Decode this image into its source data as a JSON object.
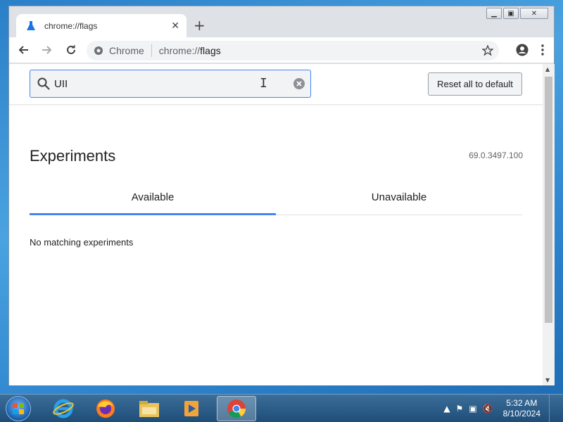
{
  "browser": {
    "tab_title": "chrome://flags",
    "new_tab_symbol": "+",
    "close_symbol": "✕",
    "omnibox": {
      "chip_label": "Chrome",
      "url_prefix": "chrome://",
      "url_host": "flags"
    }
  },
  "page": {
    "search_value": "UII",
    "reset_button_label": "Reset all to default",
    "title": "Experiments",
    "version": "69.0.3497.100",
    "tabs": [
      {
        "label": "Available",
        "selected": true
      },
      {
        "label": "Unavailable",
        "selected": false
      }
    ],
    "empty_message": "No matching experiments"
  },
  "taskbar": {
    "apps": [
      "internet-explorer-icon",
      "firefox-icon",
      "file-explorer-icon",
      "media-player-icon",
      "chrome-icon"
    ],
    "clock_time": "5:32 AM",
    "clock_date": "8/10/2024"
  },
  "colors": {
    "accent": "#4285f4",
    "taskbar": "#2b5a86"
  }
}
